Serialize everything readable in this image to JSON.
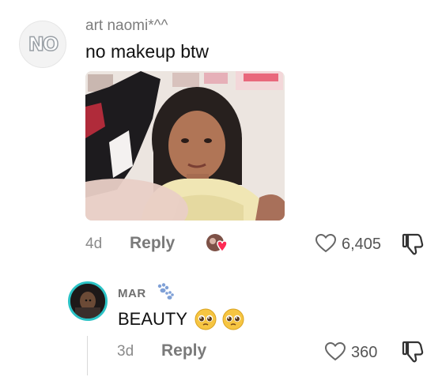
{
  "comment": {
    "username": "art naomi*^^",
    "avatar_text": "NO",
    "text": "no makeup btw",
    "time": "4d",
    "reply_label": "Reply",
    "likes": "6,405"
  },
  "reply": {
    "username": "MAR",
    "text": "BEAUTY",
    "time": "3d",
    "reply_label": "Reply",
    "likes": "360"
  },
  "icons": {
    "heart": "heart-outline-icon",
    "dislike": "thumbs-down-icon",
    "paw": "paw-icon",
    "emoji": "pleading-face-emoji",
    "sticker": "liked-by-creator-sticker"
  },
  "colors": {
    "reply_avatar_ring": "#2bc2c5",
    "sticker_heart": "#ff2b55"
  }
}
